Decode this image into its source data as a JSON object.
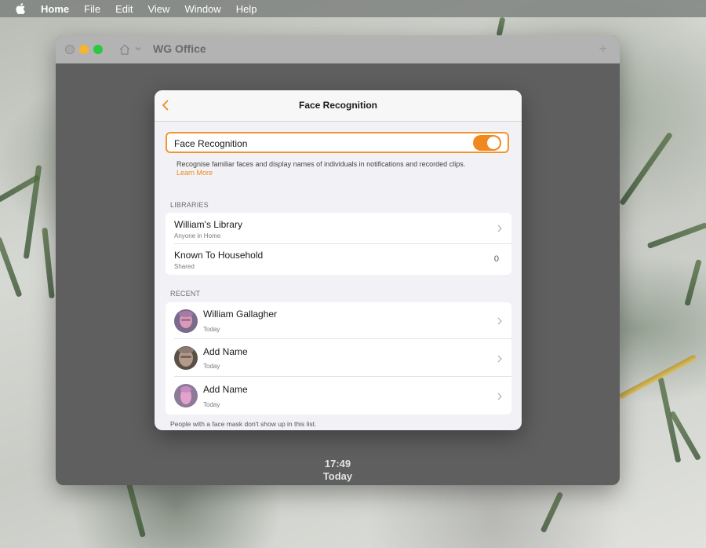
{
  "menubar": {
    "apple_icon": "apple-logo-icon",
    "items": [
      "Home",
      "File",
      "Edit",
      "View",
      "Window",
      "Help"
    ]
  },
  "window": {
    "title": "WG Office",
    "home_icon": "home-icon",
    "add_icon": "plus-icon",
    "clock_time": "17:49",
    "clock_day": "Today"
  },
  "sheet": {
    "title": "Face Recognition",
    "back_icon": "chevron-left-icon",
    "accent_color": "#f0871f",
    "toggle": {
      "label": "Face Recognition",
      "on": true
    },
    "description": "Recognise familiar faces and display names of individuals in notifications and recorded clips.",
    "learn_more": "Learn More",
    "libraries_header": "LIBRARIES",
    "libraries": [
      {
        "title": "William's Library",
        "subtitle": "Anyone in Home",
        "count": ""
      },
      {
        "title": "Known To Household",
        "subtitle": "Shared",
        "count": "0"
      }
    ],
    "recent_header": "RECENT",
    "recent": [
      {
        "name": "William Gallagher",
        "subtitle": "Today"
      },
      {
        "name": "Add Name",
        "subtitle": "Today"
      },
      {
        "name": "Add Name",
        "subtitle": "Today"
      }
    ],
    "footnote": "People with a face mask don't show up in this list."
  }
}
